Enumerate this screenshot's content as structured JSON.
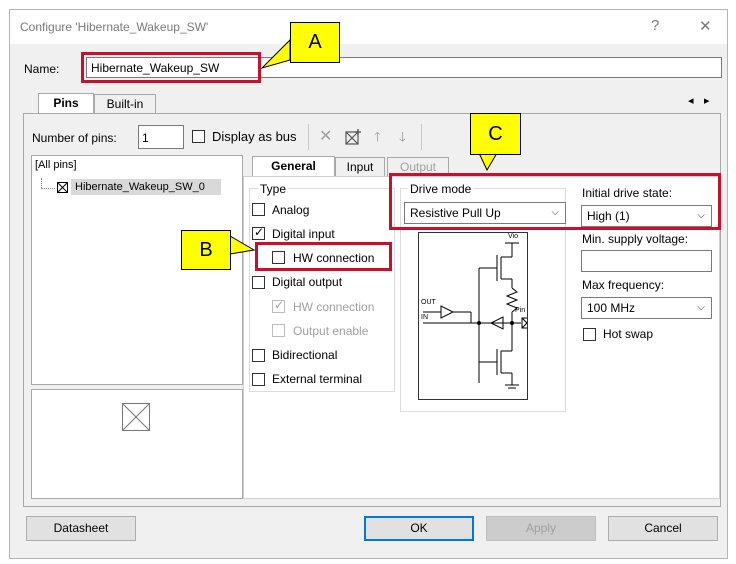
{
  "window": {
    "title": "Configure 'Hibernate_Wakeup_SW'",
    "help_glyph": "?",
    "close_glyph": "✕"
  },
  "name_field": {
    "label": "Name:",
    "value": "Hibernate_Wakeup_SW"
  },
  "top_tabs": [
    {
      "label": "Pins"
    },
    {
      "label": "Built-in"
    }
  ],
  "tab_scroll": {
    "left": "◂",
    "right": "▸"
  },
  "pins_toolbar": {
    "number_label": "Number of pins:",
    "number_value": "1",
    "display_as_bus_label": "Display as bus"
  },
  "pin_tree": {
    "root": "[All pins]",
    "pin": "Hibernate_Wakeup_SW_0"
  },
  "inner_tabs": [
    {
      "label": "General"
    },
    {
      "label": "Input"
    },
    {
      "label": "Output"
    }
  ],
  "type_group": {
    "title": "Type",
    "analog": {
      "label": "Analog",
      "checked": false
    },
    "digital_input": {
      "label": "Digital input",
      "checked": true
    },
    "di_hw_connection": {
      "label": "HW connection",
      "checked": false
    },
    "digital_output": {
      "label": "Digital output",
      "checked": false
    },
    "do_hw_connection": {
      "label": "HW connection",
      "checked": true,
      "disabled": true
    },
    "output_enable": {
      "label": "Output enable",
      "checked": false,
      "disabled": true
    },
    "bidirectional": {
      "label": "Bidirectional",
      "checked": false
    },
    "external_terminal": {
      "label": "External terminal",
      "checked": false
    }
  },
  "drive_mode": {
    "label": "Drive mode",
    "value": "Resistive Pull Up"
  },
  "schematic": {
    "vio": "Vio",
    "out": "OUT",
    "in": "IN",
    "pin": "Pin"
  },
  "right_column": {
    "initial_drive_state_label": "Initial drive state:",
    "initial_drive_state_value": "High (1)",
    "min_supply_label": "Min. supply voltage:",
    "min_supply_value": "",
    "max_freq_label": "Max frequency:",
    "max_freq_value": "100 MHz",
    "hot_swap_label": "Hot swap",
    "hot_swap_checked": false
  },
  "buttons": {
    "datasheet": "Datasheet",
    "ok": "OK",
    "apply": "Apply",
    "cancel": "Cancel"
  },
  "callouts": {
    "a": "A",
    "b": "B",
    "c": "C"
  },
  "glyphs": {
    "check": "✓",
    "chevron": "⌵",
    "delete": "✕",
    "up": "🡑",
    "down": "🡓"
  },
  "colors": {
    "highlight": "#c8102e",
    "callout": "#ffff00",
    "accent": "#0078d7"
  }
}
